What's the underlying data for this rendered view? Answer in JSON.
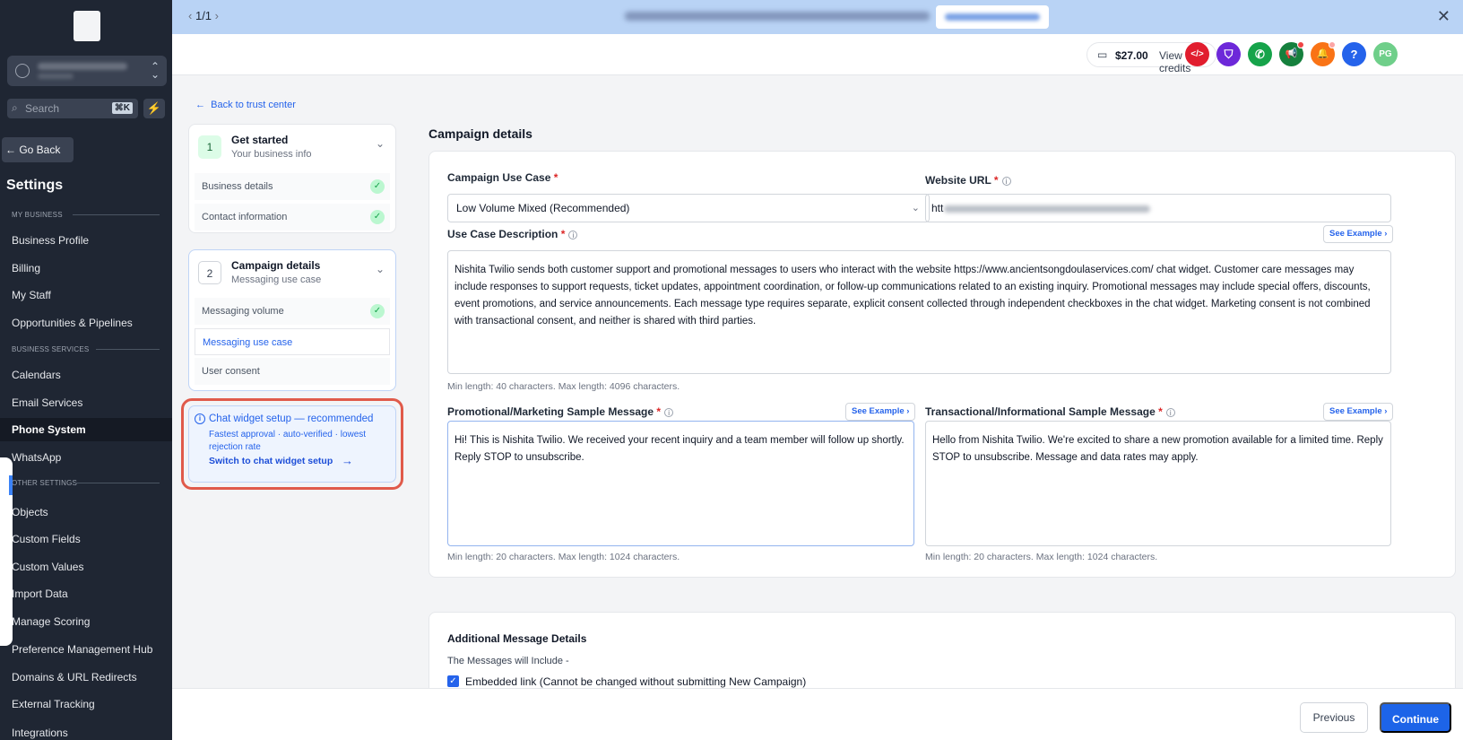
{
  "banner": {
    "pager": "1/1",
    "cta_label": "",
    "close": "✕"
  },
  "sidebar": {
    "search_placeholder": "Search",
    "search_shortcut": "⌘K",
    "go_back": "← Go Back",
    "title": "Settings",
    "sections": {
      "my_business": "MY BUSINESS",
      "business_services": "BUSINESS SERVICES",
      "other_settings": "OTHER SETTINGS"
    },
    "items": [
      "Business Profile",
      "Billing",
      "My Staff",
      "Opportunities & Pipelines",
      "Calendars",
      "Email Services",
      "Phone System",
      "WhatsApp",
      "Objects",
      "Custom Fields",
      "Custom Values",
      "Import Data",
      "Manage Scoring",
      "Preference Management Hub",
      "Domains & URL Redirects",
      "External Tracking",
      "Integrations"
    ],
    "active_item": "Phone System"
  },
  "header": {
    "credits_amount": "$27.00",
    "credits_label": "View credits",
    "icons": [
      {
        "name": "code-icon",
        "glyph": "</>",
        "color": "#e11d2e"
      },
      {
        "name": "shield-icon",
        "glyph": "⛉",
        "color": "#6d28d9"
      },
      {
        "name": "phone-icon",
        "glyph": "✆",
        "color": "#16a34a"
      },
      {
        "name": "megaphone-icon",
        "glyph": "📢",
        "color": "#15803d"
      },
      {
        "name": "bell-icon",
        "glyph": "🔔",
        "color": "#f97316"
      },
      {
        "name": "help-icon",
        "glyph": "?",
        "color": "#2563eb"
      },
      {
        "name": "user-avatar",
        "glyph": "PG",
        "color": "#6fcf8a"
      }
    ]
  },
  "nav": {
    "back_link": "Back to trust center"
  },
  "steps": {
    "step1": {
      "num": "1",
      "title": "Get started",
      "subtitle": "Your business info",
      "items": [
        "Business details",
        "Contact information"
      ]
    },
    "step2": {
      "num": "2",
      "title": "Campaign details",
      "subtitle": "Messaging use case",
      "items": [
        "Messaging volume",
        "Messaging use case",
        "User consent"
      ]
    }
  },
  "chat_widget": {
    "title": "Chat widget setup — recommended",
    "description": "Fastest approval · auto-verified · lowest rejection rate",
    "switch_label": "Switch to chat widget setup"
  },
  "campaign": {
    "section_title": "Campaign details",
    "use_case_label": "Campaign Use Case",
    "use_case_value": "Low Volume Mixed (Recommended)",
    "website_label": "Website URL",
    "website_value": "htt",
    "description_label": "Use Case Description",
    "see_example": "See Example",
    "description_value": "Nishita Twilio sends both customer support and promotional messages to users who interact with the website https://www.ancientsongdoulaservices.com/ chat widget. Customer care messages may include responses to support requests, ticket updates, appointment coordination, or follow-up communications related to an existing inquiry. Promotional messages may include special offers, discounts, event promotions, and service announcements. Each message type requires separate, explicit consent collected through independent checkboxes in the chat widget. Marketing consent is not combined with transactional consent, and neither is shared with third parties.",
    "description_hint": "Min length: 40 characters. Max length: 4096 characters.",
    "promo_label": "Promotional/Marketing Sample Message",
    "promo_value": "Hi! This is Nishita Twilio. We received your recent inquiry and a team member will follow up shortly. Reply STOP to unsubscribe.",
    "promo_hint": "Min length: 20 characters. Max length: 1024 characters.",
    "trans_label": "Transactional/Informational Sample Message",
    "trans_value": "Hello from Nishita Twilio. We're excited to share a new promotion available for a limited time. Reply STOP to unsubscribe. Message and data rates may apply.",
    "trans_hint": "Min length: 20 characters. Max length: 1024 characters."
  },
  "additional": {
    "title": "Additional Message Details",
    "subtitle": "The Messages will Include -",
    "checkbox_label": "Embedded link (Cannot be changed without submitting New Campaign)"
  },
  "footer": {
    "previous": "Previous",
    "continue": "Continue"
  }
}
